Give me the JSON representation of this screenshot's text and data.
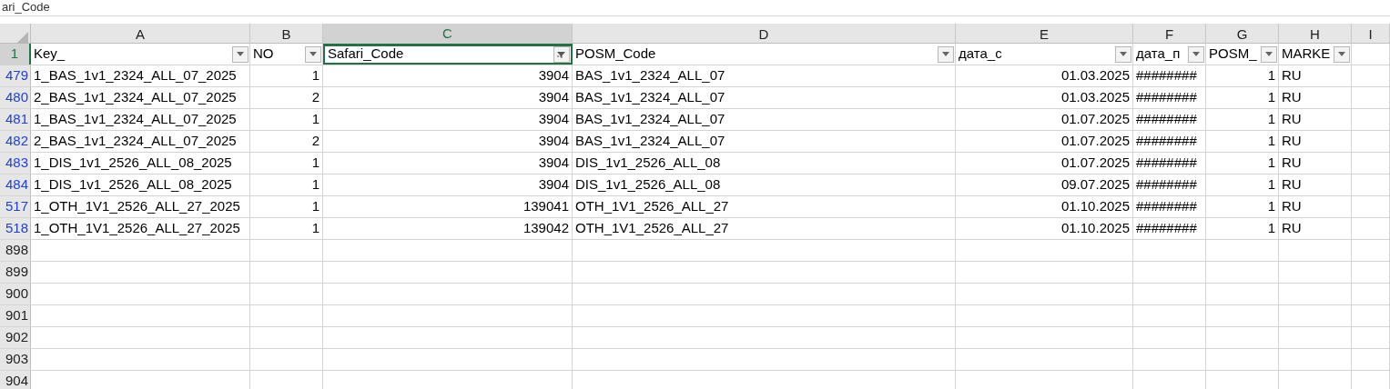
{
  "formula_bar": {
    "value": "ari_Code"
  },
  "columns": [
    {
      "letter": "A",
      "selected": false
    },
    {
      "letter": "B",
      "selected": false
    },
    {
      "letter": "C",
      "selected": true
    },
    {
      "letter": "D",
      "selected": false
    },
    {
      "letter": "E",
      "selected": false
    },
    {
      "letter": "F",
      "selected": false
    },
    {
      "letter": "G",
      "selected": false
    },
    {
      "letter": "H",
      "selected": false
    },
    {
      "letter": "I",
      "selected": false
    }
  ],
  "header_row": {
    "number": "1",
    "cells": [
      {
        "text": "Key_",
        "filter_active": false,
        "selected": false
      },
      {
        "text": "NO",
        "filter_active": false,
        "selected": false
      },
      {
        "text": "Safari_Code",
        "filter_active": true,
        "selected": true
      },
      {
        "text": "POSM_Code",
        "filter_active": false,
        "selected": false
      },
      {
        "text": "дата_с",
        "filter_active": false,
        "selected": false
      },
      {
        "text": "дата_п",
        "filter_active": false,
        "selected": false
      },
      {
        "text": "POSM_",
        "filter_active": false,
        "selected": false
      },
      {
        "text": "MARKE",
        "filter_active": false,
        "selected": false
      }
    ]
  },
  "rows": [
    {
      "number": "479",
      "filtered": true,
      "cells": [
        "1_BAS_1v1_2324_ALL_07_2025",
        "1",
        "3904",
        "BAS_1v1_2324_ALL_07",
        "01.03.2025",
        "########",
        "1",
        "RU"
      ]
    },
    {
      "number": "480",
      "filtered": true,
      "cells": [
        "2_BAS_1v1_2324_ALL_07_2025",
        "2",
        "3904",
        "BAS_1v1_2324_ALL_07",
        "01.03.2025",
        "########",
        "1",
        "RU"
      ]
    },
    {
      "number": "481",
      "filtered": true,
      "cells": [
        "1_BAS_1v1_2324_ALL_07_2025",
        "1",
        "3904",
        "BAS_1v1_2324_ALL_07",
        "01.07.2025",
        "########",
        "1",
        "RU"
      ]
    },
    {
      "number": "482",
      "filtered": true,
      "cells": [
        "2_BAS_1v1_2324_ALL_07_2025",
        "2",
        "3904",
        "BAS_1v1_2324_ALL_07",
        "01.07.2025",
        "########",
        "1",
        "RU"
      ]
    },
    {
      "number": "483",
      "filtered": true,
      "cells": [
        "1_DIS_1v1_2526_ALL_08_2025",
        "1",
        "3904",
        "DIS_1v1_2526_ALL_08",
        "01.07.2025",
        "########",
        "1",
        "RU"
      ]
    },
    {
      "number": "484",
      "filtered": true,
      "cells": [
        "1_DIS_1v1_2526_ALL_08_2025",
        "1",
        "3904",
        "DIS_1v1_2526_ALL_08",
        "09.07.2025",
        "########",
        "1",
        "RU"
      ]
    },
    {
      "number": "517",
      "filtered": true,
      "cells": [
        "1_OTH_1V1_2526_ALL_27_2025",
        "1",
        "139041",
        "OTH_1V1_2526_ALL_27",
        "01.10.2025",
        "########",
        "1",
        "RU"
      ]
    },
    {
      "number": "518",
      "filtered": true,
      "cells": [
        "1_OTH_1V1_2526_ALL_27_2025",
        "1",
        "139042",
        "OTH_1V1_2526_ALL_27",
        "01.10.2025",
        "########",
        "1",
        "RU"
      ]
    },
    {
      "number": "898",
      "filtered": false,
      "cells": []
    },
    {
      "number": "899",
      "filtered": false,
      "cells": []
    },
    {
      "number": "900",
      "filtered": false,
      "cells": []
    },
    {
      "number": "901",
      "filtered": false,
      "cells": []
    },
    {
      "number": "902",
      "filtered": false,
      "cells": []
    },
    {
      "number": "903",
      "filtered": false,
      "cells": []
    },
    {
      "number": "904",
      "filtered": false,
      "cells": []
    }
  ]
}
